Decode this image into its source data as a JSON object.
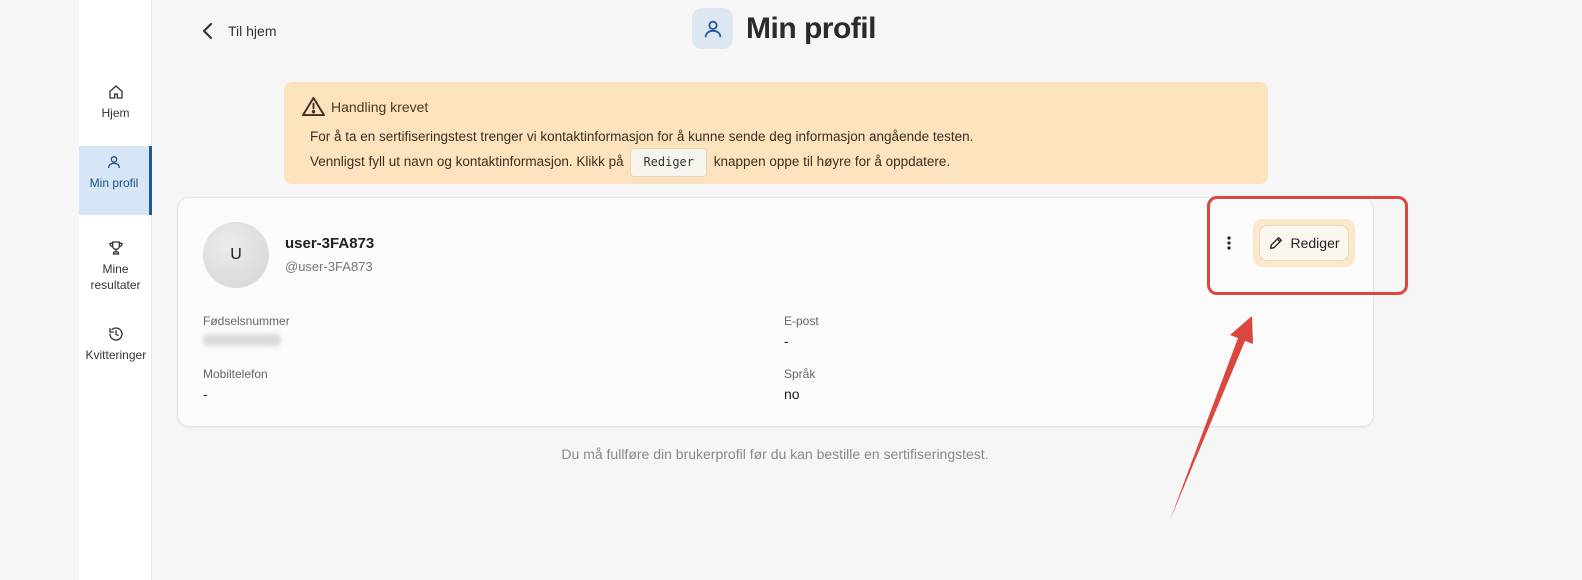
{
  "sidebar": {
    "items": [
      {
        "label": "Hjem",
        "icon": "home-icon"
      },
      {
        "label": "Min profil",
        "icon": "user-icon",
        "active": true
      },
      {
        "label": "Mine resultater",
        "icon": "trophy-icon"
      },
      {
        "label": "Kvitteringer",
        "icon": "history-icon"
      }
    ]
  },
  "header": {
    "back_label": "Til hjem",
    "title": "Min profil",
    "title_icon": "user-icon"
  },
  "alert": {
    "title": "Handling krevet",
    "line1": "For å ta en sertifiseringstest trenger vi kontaktinformasjon for å kunne sende deg informasjon angående testen.",
    "line2_before": "Vennligst fyll ut navn og kontaktinformasjon. Klikk på",
    "line2_code": "Rediger",
    "line2_after": "knappen oppe til høyre for å oppdatere.",
    "color": "#fde3bd"
  },
  "profile": {
    "avatar_initial": "U",
    "username": "user-3FA873",
    "handle": "@user-3FA873",
    "edit_label": "Rediger",
    "fields": {
      "birth_number_label": "Fødselsnummer",
      "email_label": "E-post",
      "email_value": "-",
      "phone_label": "Mobiltelefon",
      "phone_value": "-",
      "language_label": "Språk",
      "language_value": "no"
    }
  },
  "footer_note": "Du må fullføre din brukerprofil før du kan bestille en sertifiseringstest.",
  "colors": {
    "accent": "#1f5d99",
    "active_nav_bg": "#d6e6f7",
    "annotation": "#d9473d"
  }
}
